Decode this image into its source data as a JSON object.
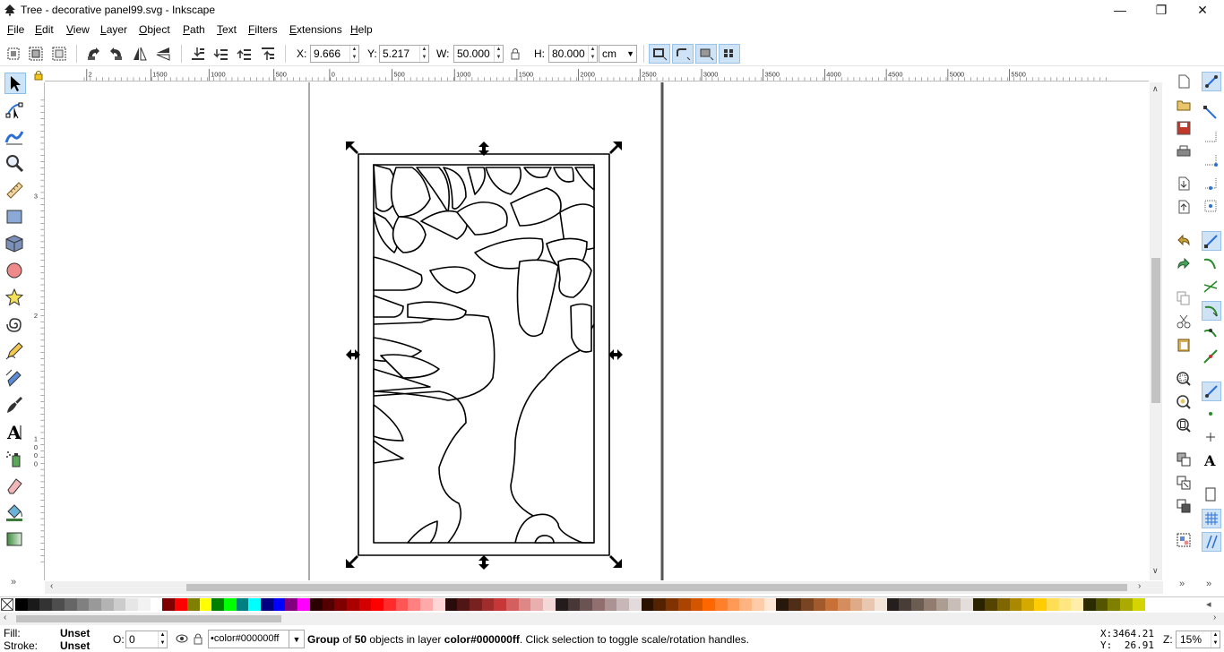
{
  "window": {
    "title": "Tree - decorative panel99.svg - Inkscape",
    "minimize": "—",
    "maximize": "❐",
    "close": "✕"
  },
  "menu": [
    {
      "label": "File",
      "u": "F",
      "rest": "ile"
    },
    {
      "label": "Edit",
      "u": "E",
      "rest": "dit"
    },
    {
      "label": "View",
      "u": "V",
      "rest": "iew"
    },
    {
      "label": "Layer",
      "u": "L",
      "rest": "ayer"
    },
    {
      "label": "Object",
      "u": "O",
      "rest": "bject"
    },
    {
      "label": "Path",
      "u": "P",
      "rest": "ath"
    },
    {
      "label": "Text",
      "u": "T",
      "rest": "ext"
    },
    {
      "label": "Filters",
      "u": "F",
      "rest": "ilters"
    },
    {
      "label": "Extensions",
      "u": "E",
      "rest": "xtensions"
    },
    {
      "label": "Help",
      "u": "H",
      "rest": "elp"
    }
  ],
  "toolbar": {
    "x_label": "X:",
    "x_value": "9.666",
    "y_label": "Y:",
    "y_value": "5.217",
    "w_label": "W:",
    "w_value": "50.000",
    "h_label": "H:",
    "h_value": "80.000",
    "unit": "cm"
  },
  "rulers": {
    "top_ticks": [
      "2",
      "1500",
      "1000",
      "500",
      "0",
      "500",
      "1000",
      "1500",
      "2000",
      "2500",
      "3000",
      "3500",
      "4000",
      "4500",
      "5000",
      "5500"
    ],
    "left_ticks": [
      "3",
      "2",
      "1",
      "0",
      "0",
      "0"
    ]
  },
  "palette": {
    "colors": [
      "#000000",
      "#1a1a1a",
      "#333333",
      "#4d4d4d",
      "#666666",
      "#808080",
      "#999999",
      "#b3b3b3",
      "#cccccc",
      "#e6e6e6",
      "#f2f2f2",
      "#ffffff",
      "#800000",
      "#ff0000",
      "#808000",
      "#ffff00",
      "#008000",
      "#00ff00",
      "#008080",
      "#00ffff",
      "#000080",
      "#0000ff",
      "#800080",
      "#ff00ff",
      "#2b0000",
      "#550000",
      "#800000",
      "#aa0000",
      "#d40000",
      "#ff0000",
      "#ff2a2a",
      "#ff5555",
      "#ff8080",
      "#ffaaaa",
      "#ffd5d5",
      "#280b0b",
      "#501616",
      "#782121",
      "#a02c2c",
      "#c83737",
      "#d35f5f",
      "#de8787",
      "#e9afaf",
      "#f4d7d7",
      "#241c1c",
      "#483737",
      "#6c5353",
      "#916f6f",
      "#ac9393",
      "#c8b7b7",
      "#e3dbdb",
      "#2b1100",
      "#552200",
      "#803300",
      "#aa4400",
      "#d45500",
      "#ff6600",
      "#ff7f2a",
      "#ff9955",
      "#ffb380",
      "#ffccaa",
      "#ffe6d5",
      "#28170b",
      "#502d16",
      "#784421",
      "#a05a2c",
      "#c87137",
      "#d38d5f",
      "#deaa87",
      "#e9c6af",
      "#f4e3d7",
      "#241f1c",
      "#483e37",
      "#6c5d53",
      "#917c6f",
      "#ac9d93",
      "#c8beb7",
      "#e3dedb",
      "#2b2200",
      "#554400",
      "#806600",
      "#aa8800",
      "#d4aa00",
      "#ffcc00",
      "#ffdd55",
      "#ffe680",
      "#ffeeaa",
      "#2b2b00",
      "#555500",
      "#808000",
      "#aaaa00",
      "#d4d400"
    ]
  },
  "status": {
    "fill_label": "Fill:",
    "fill_value": "Unset",
    "stroke_label": "Stroke:",
    "stroke_value": "Unset",
    "opacity_label": "O:",
    "opacity_value": "0",
    "layer": "•color#000000ff",
    "message_bold": "Group",
    "message_of": " of ",
    "message_count": "50",
    "message_mid": " objects in layer ",
    "message_layer": "color#000000ff",
    "message_tail": ". Click selection to toggle scale/rotation handles.",
    "cursor_x_label": "X:",
    "cursor_x": "3464.21",
    "cursor_y_label": "Y:",
    "cursor_y": "26.91",
    "zoom_label": "Z:",
    "zoom": "15%"
  }
}
